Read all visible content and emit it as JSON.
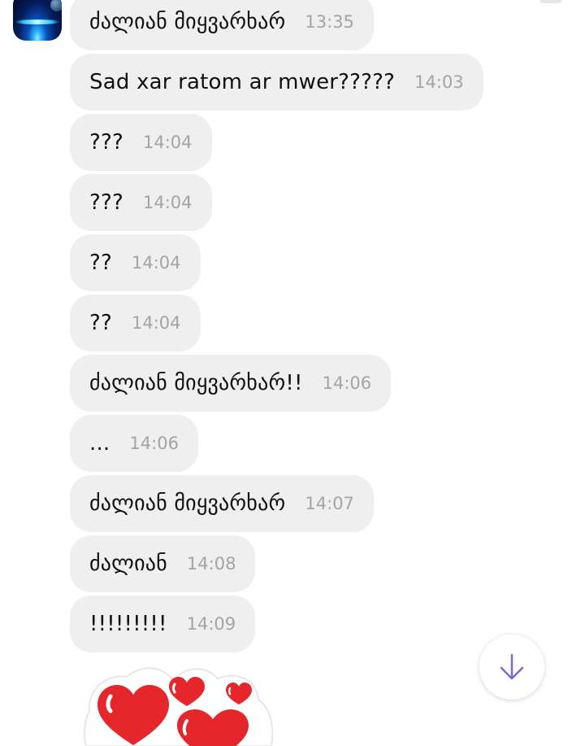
{
  "messages": [
    {
      "text": "ძალიან მიყვარხარ",
      "time": "13:35"
    },
    {
      "text": "Sad xar ratom ar mwer?????",
      "time": "14:03"
    },
    {
      "text": "???",
      "time": "14:04"
    },
    {
      "text": "???",
      "time": "14:04"
    },
    {
      "text": "??",
      "time": "14:04"
    },
    {
      "text": "??",
      "time": "14:04"
    },
    {
      "text": "ძალიან მიყვარხარ!!",
      "time": "14:06"
    },
    {
      "text": "...",
      "time": "14:06"
    },
    {
      "text": "ძალიან მიყვარხარ",
      "time": "14:07"
    },
    {
      "text": "ძალიან",
      "time": "14:08"
    },
    {
      "text": "!!!!!!!!!",
      "time": "14:09"
    }
  ],
  "icons": {
    "scroll_down": "arrow-down-icon",
    "sticker": "hearts-sticker",
    "avatar": "space-avatar"
  },
  "colors": {
    "bubble": "#efefef",
    "time": "#a4a4a4",
    "text": "#111111",
    "scroll_arrow": "#7b68d9",
    "heart": "#e82a2a"
  }
}
